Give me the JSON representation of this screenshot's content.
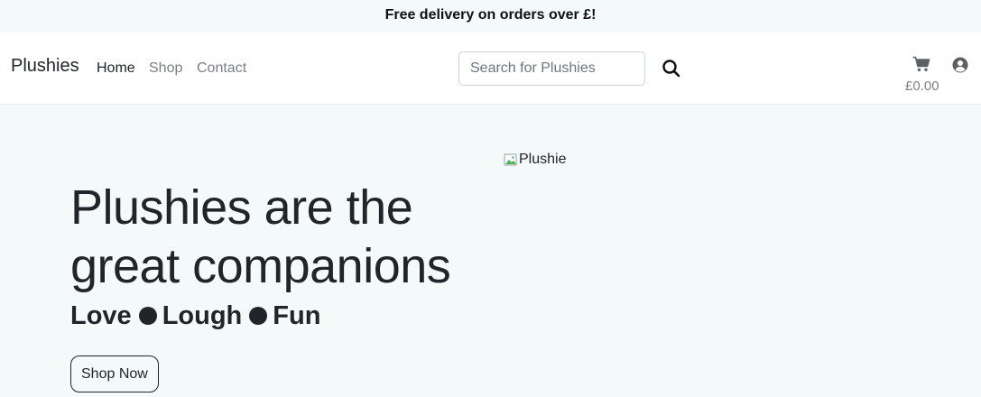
{
  "announcement": {
    "text": "Free delivery on orders over £!"
  },
  "navbar": {
    "brand": "Plushies",
    "links": [
      {
        "label": "Home",
        "active": true
      },
      {
        "label": "Shop",
        "active": false
      },
      {
        "label": "Contact",
        "active": false
      }
    ],
    "search": {
      "placeholder": "Search for Plushies",
      "value": "",
      "button_icon": "search-icon"
    },
    "cart": {
      "icon": "cart-icon",
      "total": "£0.00"
    },
    "account": {
      "icon": "user-circle-icon"
    }
  },
  "hero": {
    "title": "Plushies are the great companions",
    "tagline": {
      "words": [
        "Love",
        "Lough",
        "Fun"
      ],
      "separator": "●"
    },
    "cta_label": "Shop Now",
    "image_alt": "Plushie"
  },
  "colors": {
    "background": "#f4f9f9",
    "navbar_bg": "#ffffff",
    "text": "#212529",
    "muted": "#7b7f84"
  }
}
